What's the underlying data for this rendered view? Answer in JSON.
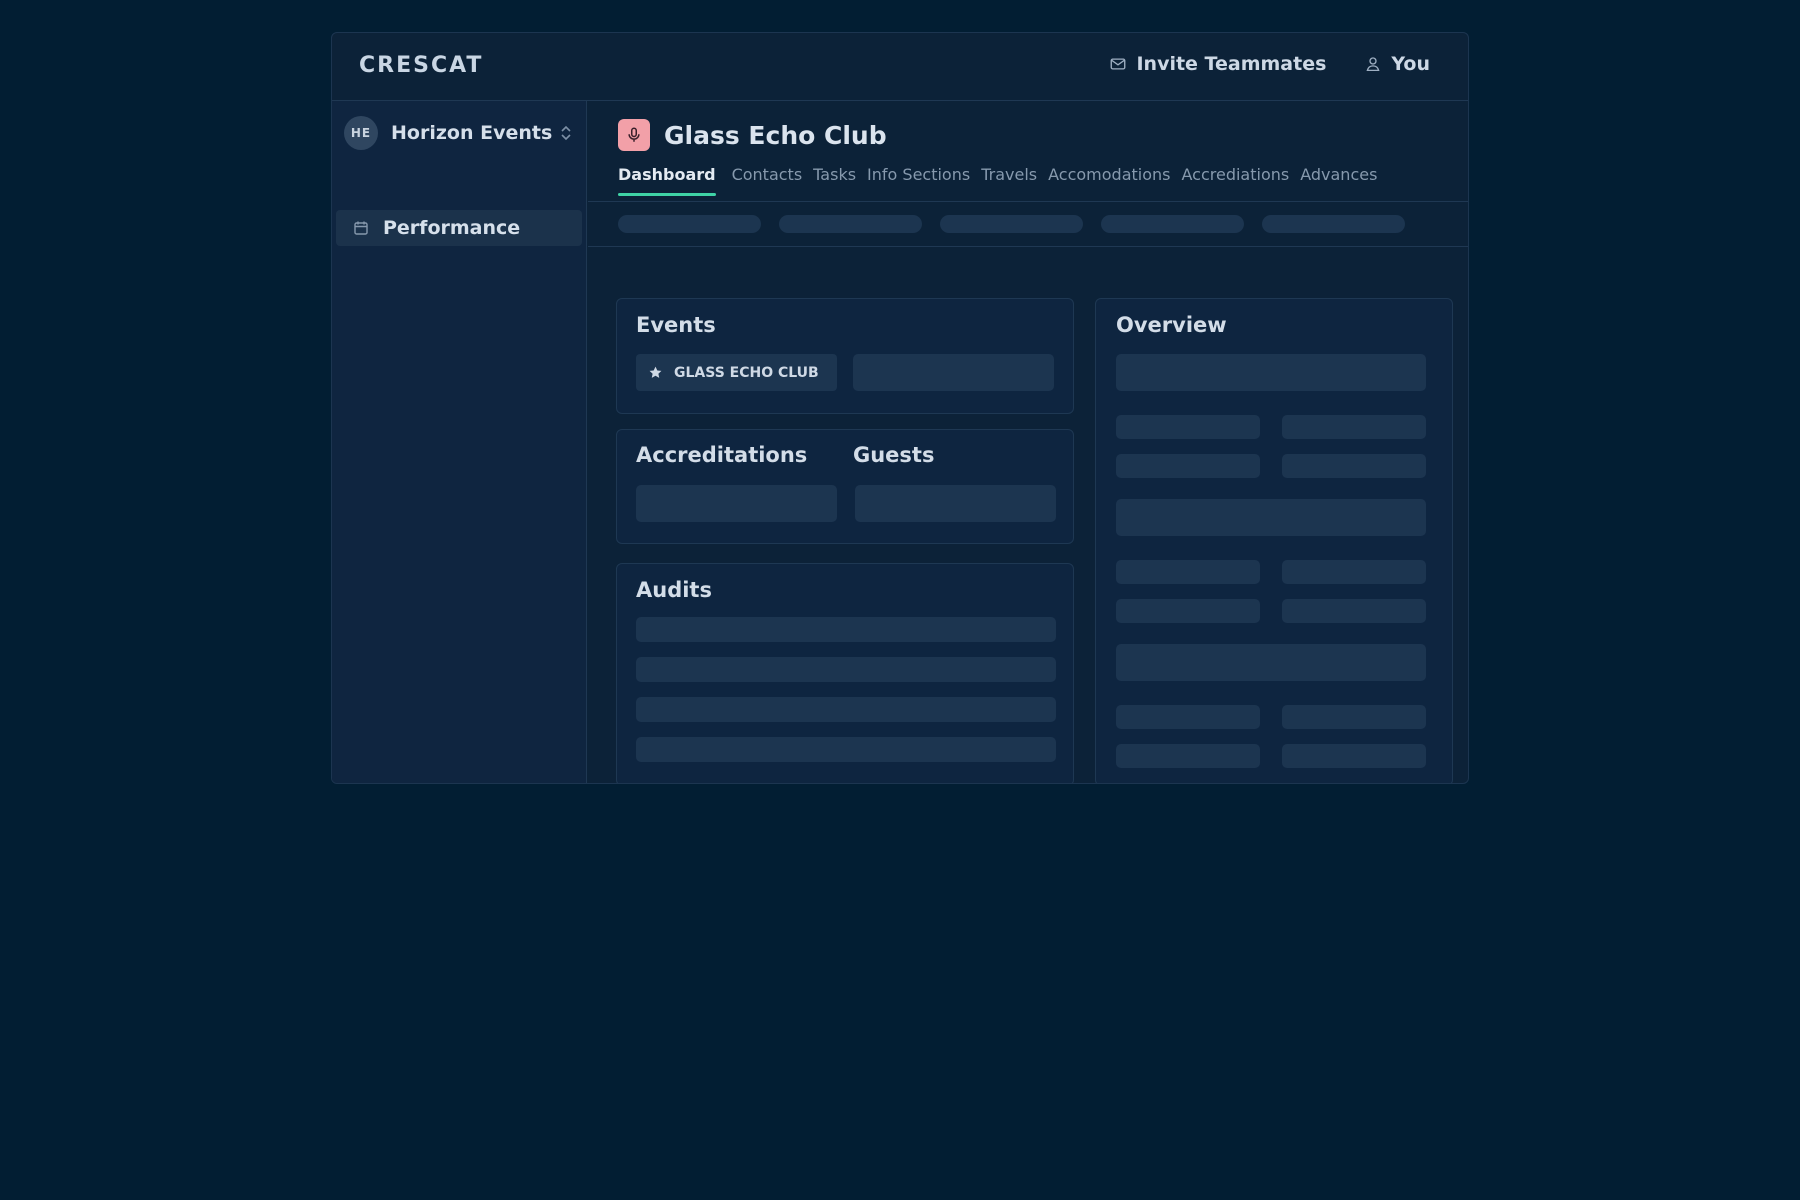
{
  "header": {
    "brand": "CRESCAT",
    "invite_label": "Invite Teammates",
    "user_label": "You"
  },
  "sidebar": {
    "workspace": {
      "initials": "HE",
      "name": "Horizon Events"
    },
    "items": [
      {
        "label": "Performance",
        "icon": "calendar-icon",
        "active": true
      }
    ]
  },
  "event": {
    "title": "Glass Echo Club",
    "icon": "microphone-icon",
    "icon_color": "#f2a0a8"
  },
  "tabs": [
    {
      "label": "Dashboard",
      "active": true
    },
    {
      "label": "Contacts"
    },
    {
      "label": "Tasks"
    },
    {
      "label": "Info Sections"
    },
    {
      "label": "Travels"
    },
    {
      "label": "Accomodations"
    },
    {
      "label": "Accrediations"
    },
    {
      "label": "Advances"
    }
  ],
  "cards": {
    "events": {
      "title": "Events",
      "chip_label": "GLASS ECHO CLUB"
    },
    "accreditations": {
      "title": "Accreditations"
    },
    "guests": {
      "title": "Guests"
    },
    "audits": {
      "title": "Audits"
    },
    "overview": {
      "title": "Overview"
    }
  },
  "colors": {
    "background": "#021e33",
    "accent": "#3fd3a6",
    "skeleton": "#1c3550"
  }
}
